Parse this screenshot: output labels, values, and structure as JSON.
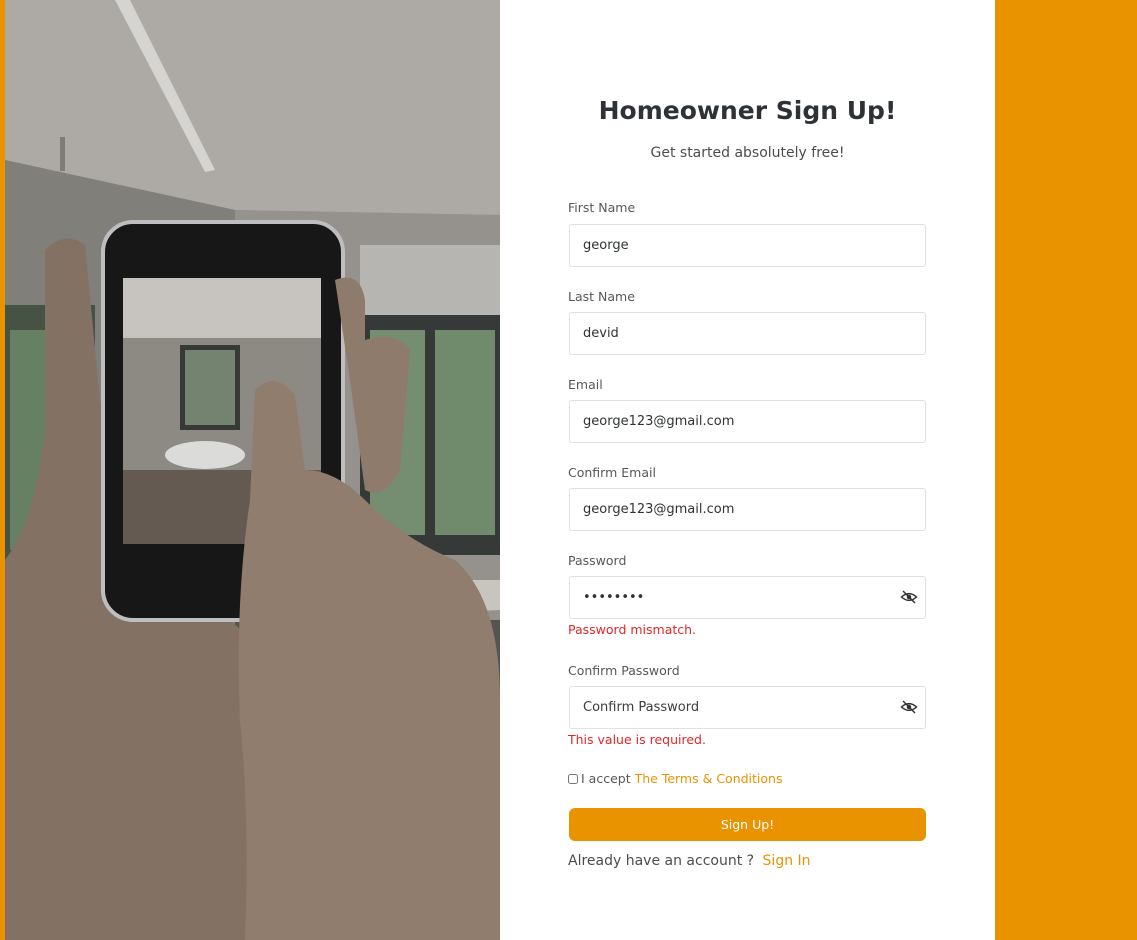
{
  "colors": {
    "accent": "#e99300",
    "error": "#e0262a",
    "title": "#2e3236"
  },
  "hero": {
    "image": "hand-holding-phone-bathroom-photo"
  },
  "form": {
    "title": "Homeowner Sign Up!",
    "subtitle": "Get started absolutely free!",
    "first_name": {
      "label": "First Name",
      "value": "george"
    },
    "last_name": {
      "label": "Last Name",
      "value": "devid"
    },
    "email": {
      "label": "Email",
      "value": "george123@gmail.com"
    },
    "confirm_email": {
      "label": "Confirm Email",
      "value": "george123@gmail.com"
    },
    "password": {
      "label": "Password",
      "value": "••••••••",
      "icon": "eye-off-icon",
      "error": "Password mismatch."
    },
    "confirm_password": {
      "label": "Confirm Password",
      "placeholder": "Confirm Password",
      "icon": "eye-off-icon",
      "error": "This value is required."
    },
    "terms": {
      "prefix": "I accept",
      "link": "The Terms & Conditions"
    },
    "submit_label": "Sign Up!",
    "signin": {
      "prefix": "Already have an account ?",
      "link": "Sign In"
    }
  }
}
